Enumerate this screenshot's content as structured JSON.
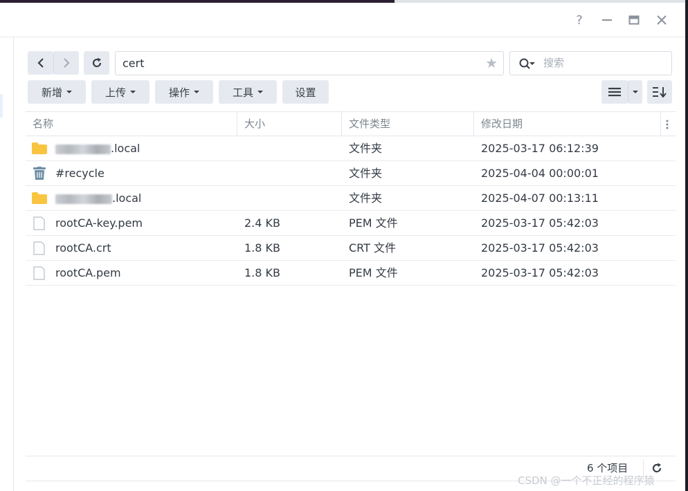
{
  "titlebar": {
    "help_icon": "?",
    "minimize_icon": "—",
    "maximize_icon": "▭",
    "close_icon": "✕"
  },
  "nav": {
    "back_icon": "‹",
    "forward_icon": "›",
    "refresh_icon": "↻"
  },
  "path": {
    "value": "cert",
    "favorite_icon": "★"
  },
  "search": {
    "placeholder": "搜索"
  },
  "toolbar": {
    "create_label": "新增",
    "upload_label": "上传",
    "action_label": "操作",
    "tools_label": "工具",
    "settings_label": "设置"
  },
  "columns": {
    "name": "名称",
    "size": "大小",
    "type": "文件类型",
    "modified": "修改日期"
  },
  "rows": [
    {
      "icon": "folder-icon",
      "name_suffix": ".local",
      "size": "",
      "type": "文件夹",
      "modified": "2025-03-17 06:12:39"
    },
    {
      "icon": "recycle-bin-icon",
      "name": "#recycle",
      "size": "",
      "type": "文件夹",
      "modified": "2025-04-04 00:00:01"
    },
    {
      "icon": "folder-icon",
      "name_suffix": ".local",
      "size": "",
      "type": "文件夹",
      "modified": "2025-04-07 00:13:11"
    },
    {
      "icon": "file-icon",
      "name": "rootCA-key.pem",
      "size": "2.4 KB",
      "type": "PEM 文件",
      "modified": "2025-03-17 05:42:03"
    },
    {
      "icon": "file-icon",
      "name": "rootCA.crt",
      "size": "1.8 KB",
      "type": "CRT 文件",
      "modified": "2025-03-17 05:42:03"
    },
    {
      "icon": "file-icon",
      "name": "rootCA.pem",
      "size": "1.8 KB",
      "type": "PEM 文件",
      "modified": "2025-03-17 05:42:03"
    }
  ],
  "footer": {
    "count_label": "6 个项目",
    "watermark": "CSDN @一个不正经的程序猿"
  },
  "colors": {
    "folder": "#f9c440",
    "recycle": "#6f8ea6",
    "button_bg": "#e6eaf0",
    "border": "#d6dbe1"
  }
}
